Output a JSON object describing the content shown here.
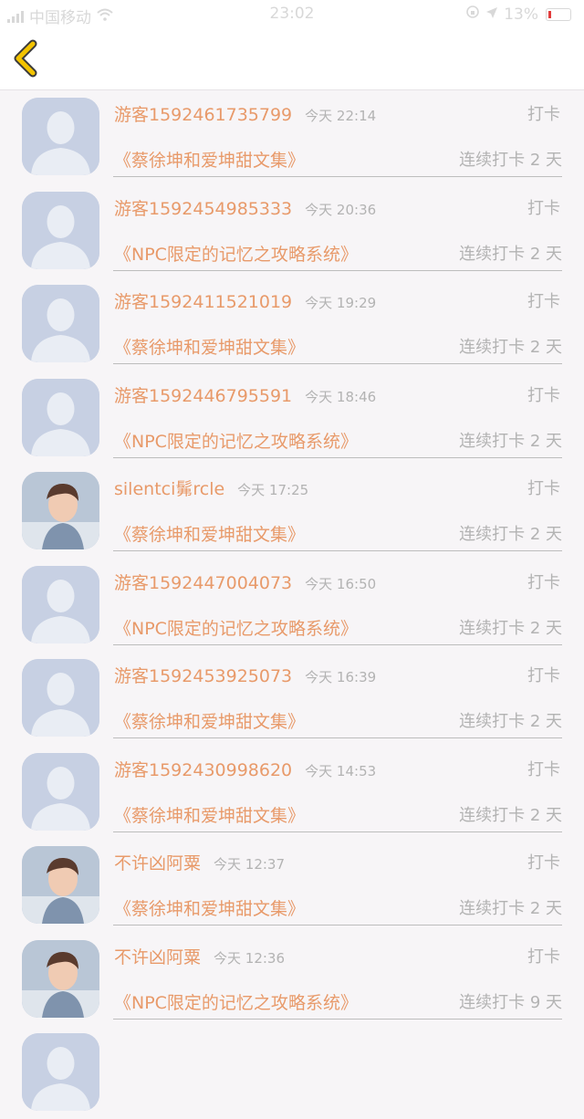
{
  "status_bar": {
    "carrier": "中国移动",
    "time": "23:02",
    "battery": "13%"
  },
  "colors": {
    "accent": "#e89a6a",
    "back_arrow": "#f2c300",
    "placeholder_avatar": "#c7d0e3"
  },
  "entries": [
    {
      "name": "游客1592461735799",
      "time": "今天 22:14",
      "action": "打卡",
      "book": "《蔡徐坤和爱坤甜文集》",
      "streak": "连续打卡 2 天",
      "avatar": "placeholder-avatar"
    },
    {
      "name": "游客1592454985333",
      "time": "今天 20:36",
      "action": "打卡",
      "book": "《NPC限定的记忆之攻略系统》",
      "streak": "连续打卡 2 天",
      "avatar": "placeholder-avatar"
    },
    {
      "name": "游客1592411521019",
      "time": "今天 19:29",
      "action": "打卡",
      "book": "《蔡徐坤和爱坤甜文集》",
      "streak": "连续打卡 2 天",
      "avatar": "placeholder-avatar"
    },
    {
      "name": "游客1592446795591",
      "time": "今天 18:46",
      "action": "打卡",
      "book": "《NPC限定的记忆之攻略系统》",
      "streak": "连续打卡 2 天",
      "avatar": "placeholder-avatar"
    },
    {
      "name": "silentci髴rcle",
      "time": "今天 17:25",
      "action": "打卡",
      "book": "《蔡徐坤和爱坤甜文集》",
      "streak": "连续打卡 2 天",
      "avatar": "photo-avatar"
    },
    {
      "name": "游客1592447004073",
      "time": "今天 16:50",
      "action": "打卡",
      "book": "《NPC限定的记忆之攻略系统》",
      "streak": "连续打卡 2 天",
      "avatar": "placeholder-avatar"
    },
    {
      "name": "游客1592453925073",
      "time": "今天 16:39",
      "action": "打卡",
      "book": "《蔡徐坤和爱坤甜文集》",
      "streak": "连续打卡 2 天",
      "avatar": "placeholder-avatar"
    },
    {
      "name": "游客1592430998620",
      "time": "今天 14:53",
      "action": "打卡",
      "book": "《蔡徐坤和爱坤甜文集》",
      "streak": "连续打卡 2 天",
      "avatar": "placeholder-avatar"
    },
    {
      "name": "不许凶阿粟",
      "time": "今天 12:37",
      "action": "打卡",
      "book": "《蔡徐坤和爱坤甜文集》",
      "streak": "连续打卡 2 天",
      "avatar": "photo-avatar"
    },
    {
      "name": "不许凶阿粟",
      "time": "今天 12:36",
      "action": "打卡",
      "book": "《NPC限定的记忆之攻略系统》",
      "streak": "连续打卡 9 天",
      "avatar": "photo-avatar"
    }
  ]
}
